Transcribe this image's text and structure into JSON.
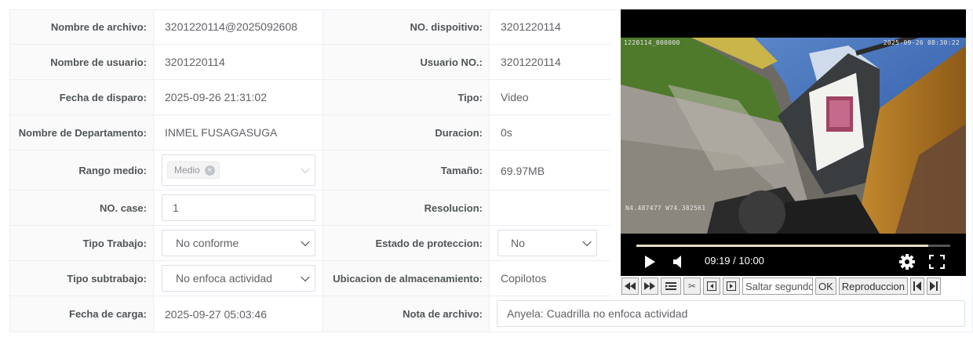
{
  "fields": {
    "file_name": {
      "label": "Nombre de archivo:",
      "value": "3201220114@2025092608"
    },
    "device_no": {
      "label": "NO. dispoitivo:",
      "value": "3201220114"
    },
    "user_name": {
      "label": "Nombre de usuario:",
      "value": "3201220114"
    },
    "user_no": {
      "label": "Usuario NO.:",
      "value": "3201220114"
    },
    "trigger_date": {
      "label": "Fecha de disparo:",
      "value": "2025-09-26 21:31:02"
    },
    "type": {
      "label": "Tipo:",
      "value": "Video"
    },
    "department": {
      "label": "Nombre de Departamento:",
      "value": "INMEL FUSAGASUGA"
    },
    "duration": {
      "label": "Duracion:",
      "value": "0s"
    },
    "medium_range": {
      "label": "Rango medio:",
      "tag": "Medio"
    },
    "size": {
      "label": "Tamaño:",
      "value": "69.97MB"
    },
    "case_no": {
      "label": "NO. case:",
      "value": "1"
    },
    "resolution": {
      "label": "Resolucion:",
      "value": ""
    },
    "work_type": {
      "label": "Tipo Trabajo:",
      "value": "No conforme"
    },
    "protection_state": {
      "label": "Estado de proteccion:",
      "value": "No"
    },
    "work_subtype": {
      "label": "Tipo subtrabajo:",
      "value": "No enfoca actividad"
    },
    "storage_location": {
      "label": "Ubicacion de almacenamiento:",
      "value": "Copilotos"
    },
    "upload_date": {
      "label": "Fecha de carga:",
      "value": "2025-09-27 05:03:46"
    },
    "file_note": {
      "label": "Nota de archivo:",
      "value": "Anyela: Cuadrilla no enfoca actividad"
    }
  },
  "video": {
    "osd_id": "1220114_000000",
    "osd_datetime": "2025-09-26 08:30:22",
    "osd_gps": "N4.487477 W74.382561",
    "current_time": "09:19",
    "total_time": "10:00",
    "time_display": "09:19 / 10:00",
    "progress": 0.93
  },
  "toolbar": {
    "jump_placeholder": "Saltar segundos",
    "ok_label": "OK",
    "playback_label": "Reproduccion"
  },
  "icons": {
    "play": "play-icon",
    "volume": "volume-icon",
    "settings": "gear-icon",
    "fullscreen": "fullscreen-icon",
    "rewind": "rewind-icon",
    "forward": "fast-forward-icon",
    "list": "list-icon",
    "scissors": "scissors-icon",
    "prev_frame": "previous-frame-icon",
    "next_frame": "next-frame-icon",
    "skip_start": "skip-start-icon",
    "skip_end": "skip-end-icon"
  }
}
